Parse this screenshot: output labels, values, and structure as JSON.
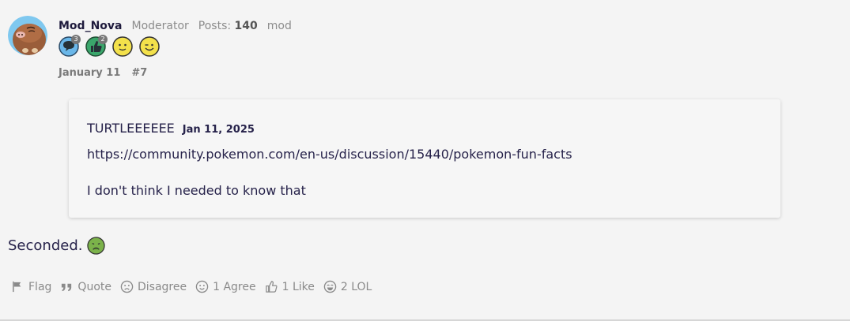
{
  "author": {
    "username": "Mod_Nova",
    "role": "Moderator",
    "posts_label": "Posts:",
    "posts_count": "140",
    "tag": "mod",
    "badges": [
      {
        "icon": "speech-bubble-icon",
        "count": "3",
        "color": "#6ab7e9"
      },
      {
        "icon": "thumbs-up-icon",
        "count": "2",
        "color": "#3aa66b"
      },
      {
        "icon": "smile-face-icon",
        "count": "",
        "color": "#f3e14b"
      },
      {
        "icon": "wink-face-icon",
        "count": "",
        "color": "#f3e14b"
      }
    ]
  },
  "meta": {
    "date": "January 11",
    "post_number": "#7"
  },
  "quote": {
    "author": "TURTLEEEEEE",
    "date": "Jan 11, 2025",
    "link": "https://community.pokemon.com/en-us/discussion/15440/pokemon-fun-facts",
    "text": "I don't think I needed to know that"
  },
  "body": {
    "text": "Seconded.",
    "emoji": "nauseated-face-icon"
  },
  "actions": [
    {
      "icon": "flag-icon",
      "label": "Flag"
    },
    {
      "icon": "quote-icon",
      "label": "Quote"
    },
    {
      "icon": "frown-face-icon",
      "label": "Disagree"
    },
    {
      "icon": "smile-face-icon",
      "label": "1 Agree"
    },
    {
      "icon": "thumbs-up-icon",
      "label": "1 Like"
    },
    {
      "icon": "laugh-face-icon",
      "label": "2 LOL"
    }
  ]
}
